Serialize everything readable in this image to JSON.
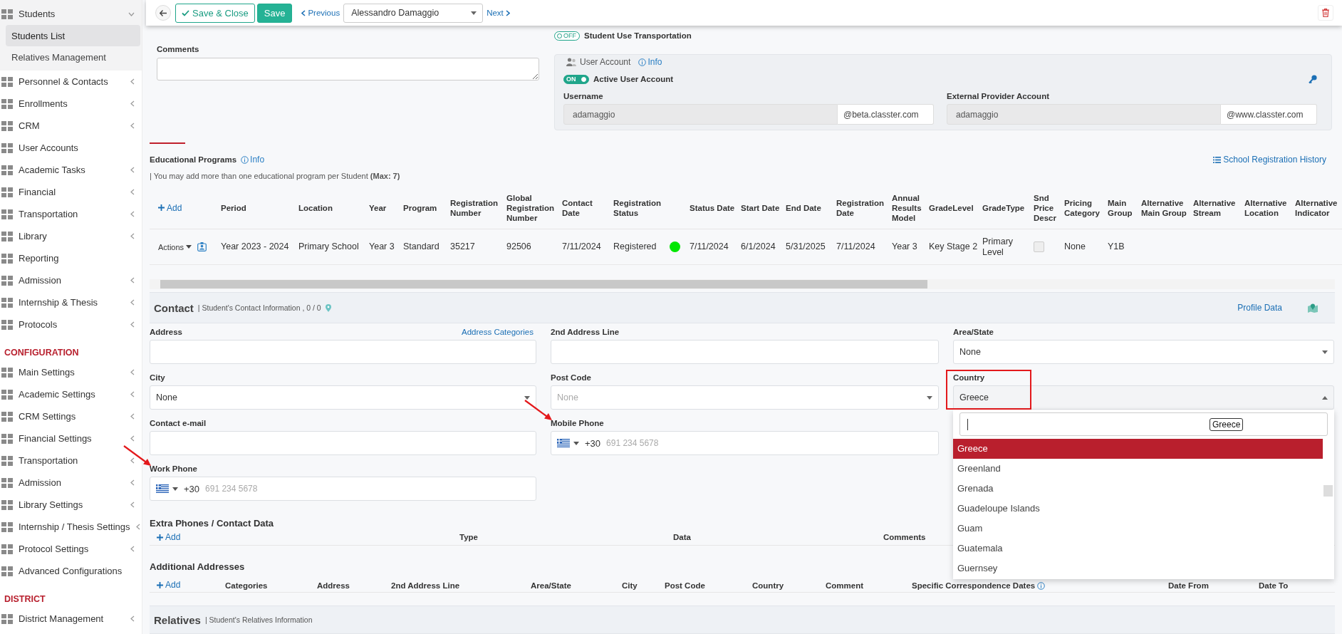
{
  "sidebar": {
    "sections": [
      {
        "items": [
          {
            "label": "Students",
            "submenu": true,
            "expanded": true,
            "children": [
              {
                "label": "Students List",
                "selected": true
              },
              {
                "label": "Relatives Management",
                "selected": false
              }
            ]
          },
          {
            "label": "Personnel & Contacts",
            "submenu": true,
            "expanded": false
          },
          {
            "label": "Enrollments",
            "submenu": true,
            "expanded": false
          },
          {
            "label": "CRM",
            "submenu": true,
            "expanded": false
          },
          {
            "label": "User Accounts",
            "submenu": false,
            "expanded": false
          },
          {
            "label": "Academic Tasks",
            "submenu": true,
            "expanded": false
          },
          {
            "label": "Financial",
            "submenu": true,
            "expanded": false
          },
          {
            "label": "Transportation",
            "submenu": true,
            "expanded": false
          },
          {
            "label": "Library",
            "submenu": true,
            "expanded": false
          },
          {
            "label": "Reporting",
            "submenu": false,
            "expanded": false
          },
          {
            "label": "Admission",
            "submenu": true,
            "expanded": false
          },
          {
            "label": "Internship & Thesis",
            "submenu": true,
            "expanded": false
          },
          {
            "label": "Protocols",
            "submenu": true,
            "expanded": false
          }
        ]
      },
      {
        "heading": "CONFIGURATION",
        "items": [
          {
            "label": "Main Settings",
            "submenu": true,
            "expanded": false
          },
          {
            "label": "Academic Settings",
            "submenu": true,
            "expanded": false
          },
          {
            "label": "CRM Settings",
            "submenu": true,
            "expanded": false
          },
          {
            "label": "Financial Settings",
            "submenu": true,
            "expanded": false
          },
          {
            "label": "Transportation",
            "submenu": true,
            "expanded": false
          },
          {
            "label": "Admission",
            "submenu": true,
            "expanded": false
          },
          {
            "label": "Library Settings",
            "submenu": true,
            "expanded": false
          },
          {
            "label": "Internship / Thesis Settings",
            "submenu": true,
            "expanded": false
          },
          {
            "label": "Protocol Settings",
            "submenu": true,
            "expanded": false
          },
          {
            "label": "Advanced Configurations",
            "submenu": false,
            "expanded": false
          }
        ]
      },
      {
        "heading": "DISTRICT",
        "items": [
          {
            "label": "District Management",
            "submenu": true,
            "expanded": false
          }
        ]
      }
    ]
  },
  "toolbar": {
    "save_close": "Save & Close",
    "save": "Save",
    "previous": "Previous",
    "record": "Alessandro Damaggio",
    "next": "Next"
  },
  "comments": {
    "label": "Comments"
  },
  "transport_toggle": {
    "on": false,
    "state_text": "OFF",
    "label": "Student Use Transportation"
  },
  "user_account": {
    "title": "User Account",
    "info": "Info",
    "toggle": {
      "on": true,
      "state_text": "ON",
      "label": "Active User Account"
    },
    "fields": [
      {
        "label": "Username",
        "value": "adamaggio",
        "suffix": "@beta.classter.com"
      },
      {
        "label": "External Provider Account",
        "value": "adamaggio",
        "suffix": "@www.classter.com"
      }
    ]
  },
  "educational_programs": {
    "title": "Educational Programs",
    "info": "Info",
    "history_link": "School Registration History",
    "note": "| You may add more than one educational program per Student **(Max: 7)**",
    "add": "Add",
    "columns": [
      {
        "kind": "header",
        "label": "Period"
      },
      {
        "kind": "header",
        "label": "Location"
      },
      {
        "kind": "header",
        "label": "Year"
      },
      {
        "kind": "header",
        "label": "Program"
      },
      {
        "kind": "header",
        "label": "Registration Number"
      },
      {
        "kind": "header",
        "label": "Global Registration Number"
      },
      {
        "kind": "header",
        "label": "Contact Date"
      },
      {
        "kind": "header",
        "label": "Registration Status"
      },
      {
        "kind": "blank"
      },
      {
        "kind": "header",
        "label": "Status Date"
      },
      {
        "kind": "header",
        "label": "Start Date"
      },
      {
        "kind": "header",
        "label": "End Date"
      },
      {
        "kind": "header",
        "label": "Registration Date"
      },
      {
        "kind": "header",
        "label": "Annual Results Model"
      },
      {
        "kind": "header",
        "label": "GradeLevel"
      },
      {
        "kind": "header",
        "label": "GradeType"
      },
      {
        "kind": "header",
        "label": "Snd Price Descr"
      },
      {
        "kind": "header",
        "label": "Pricing Category"
      },
      {
        "kind": "header",
        "label": "Main Group"
      },
      {
        "kind": "header",
        "label": "Alternative Main Group"
      },
      {
        "kind": "header",
        "label": "Alternative Stream"
      },
      {
        "kind": "header",
        "label": "Alternative Location"
      },
      {
        "kind": "header",
        "label": "Alternative Indicator"
      }
    ],
    "rows": [
      {
        "actions": "Actions",
        "cells": [
          {
            "kind": "text",
            "text": "Year 2023 - 2024"
          },
          {
            "kind": "text",
            "text": "Primary School"
          },
          {
            "kind": "text",
            "text": "Year 3"
          },
          {
            "kind": "text",
            "text": "Standard"
          },
          {
            "kind": "text",
            "text": "35217"
          },
          {
            "kind": "text",
            "text": "92506"
          },
          {
            "kind": "text",
            "text": "7/11/2024"
          },
          {
            "kind": "text",
            "text": "Registered"
          },
          {
            "kind": "dot",
            "color": "#00e600"
          },
          {
            "kind": "text",
            "text": "7/11/2024"
          },
          {
            "kind": "text",
            "text": "6/1/2024"
          },
          {
            "kind": "text",
            "text": "5/31/2025"
          },
          {
            "kind": "text",
            "text": "7/11/2024"
          },
          {
            "kind": "text",
            "text": "Year 3"
          },
          {
            "kind": "text",
            "text": "Key Stage 2"
          },
          {
            "kind": "text",
            "text": "Primary Level"
          },
          {
            "kind": "checkbox",
            "checked": false
          },
          {
            "kind": "text",
            "text": "None"
          },
          {
            "kind": "text",
            "text": "Y1B"
          }
        ]
      }
    ]
  },
  "contact": {
    "title": "Contact",
    "subtitle": "| Student's Contact Information , 0 / 0",
    "profile_link": "Profile Data",
    "rows": [
      [
        {
          "kind": "text",
          "label": "Address",
          "link": "Address Categories"
        },
        {
          "kind": "text",
          "label": "2nd Address Line"
        },
        {
          "kind": "select",
          "label": "Area/State",
          "value": "None",
          "open": false
        }
      ],
      [
        {
          "kind": "select",
          "label": "City",
          "value": "None",
          "open": false
        },
        {
          "kind": "select",
          "label": "Post Code",
          "placeholder": "None",
          "open": false
        },
        {
          "kind": "select",
          "label": "Country",
          "value": "Greece",
          "open": true,
          "highlighted": true,
          "search_tooltip": "Greece",
          "options": [
            {
              "label": "Greece",
              "selected": true
            },
            {
              "label": "Greenland",
              "selected": false
            },
            {
              "label": "Grenada",
              "selected": false
            },
            {
              "label": "Guadeloupe Islands",
              "selected": false
            },
            {
              "label": "Guam",
              "selected": false
            },
            {
              "label": "Guatemala",
              "selected": false
            },
            {
              "label": "Guernsey",
              "selected": false
            }
          ]
        }
      ],
      [
        {
          "kind": "text",
          "label": "Contact e-mail"
        },
        {
          "kind": "phone",
          "label": "Mobile Phone",
          "dial_code": "+30",
          "placeholder": "691 234 5678",
          "arrow": true
        }
      ],
      [
        {
          "kind": "phone",
          "label": "Work Phone",
          "dial_code": "+30",
          "placeholder": "691 234 5678",
          "arrow": true
        }
      ]
    ]
  },
  "extra_phones": {
    "title": "Extra Phones / Contact Data",
    "add": "Add",
    "columns": [
      {
        "label": "Type"
      },
      {
        "label": "Data"
      },
      {
        "label": "Comments"
      }
    ]
  },
  "additional_addresses": {
    "title": "Additional Addresses",
    "add": "Add",
    "columns": [
      {
        "label": "Categories"
      },
      {
        "label": "Address"
      },
      {
        "label": "2nd Address Line"
      },
      {
        "label": "Area/State"
      },
      {
        "label": "City"
      },
      {
        "label": "Post Code"
      },
      {
        "label": "Country"
      },
      {
        "label": "Comment"
      },
      {
        "label": "Specific Correspondence Dates",
        "info": true
      },
      {
        "label": "Date From"
      },
      {
        "label": "Date To"
      }
    ]
  },
  "relatives": {
    "title": "Relatives",
    "subtitle": "| Student's Relatives Information"
  }
}
